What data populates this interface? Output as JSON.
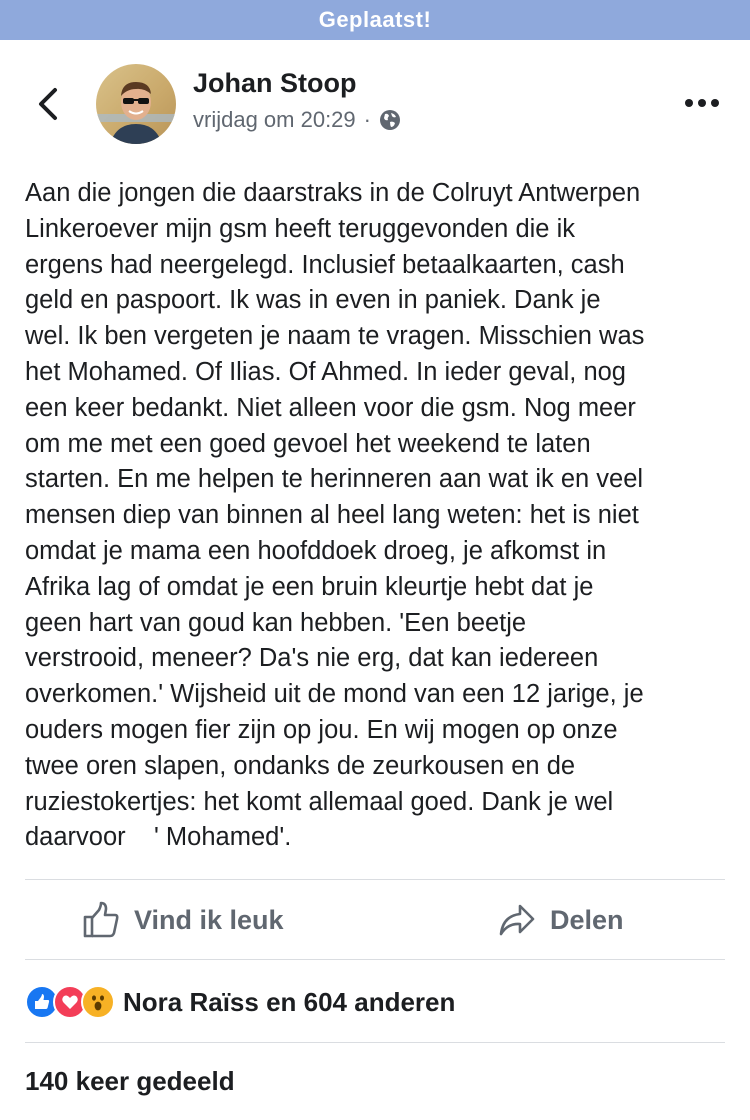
{
  "status_banner": {
    "text": "Geplaatst!",
    "color": "#8fa9dc"
  },
  "header": {
    "back_icon": "chevron-left-icon",
    "author_name": "Johan Stoop",
    "timestamp": "vrijdag om 20:29",
    "separator": "·",
    "privacy_icon": "globe-icon",
    "more_icon": "more-horizontal-icon"
  },
  "post": {
    "text": "Aan die jongen die daarstraks in de Colruyt Antwerpen\nLinkeroever mijn gsm heeft teruggevonden die ik\nergens had neergelegd. Inclusief betaalkaarten, cash\ngeld en paspoort. Ik was in even in paniek. Dank je\nwel. Ik ben vergeten je naam te vragen. Misschien was\nhet Mohamed. Of Ilias. Of Ahmed. In ieder geval, nog\neen keer bedankt. Niet alleen voor die gsm. Nog meer\nom me met een goed gevoel het weekend te laten\nstarten. En me helpen te herinneren aan wat ik en veel\nmensen diep van binnen al heel lang weten: het is niet\nomdat je mama een hoofddoek droeg, je afkomst in\nAfrika lag of omdat je een bruin kleurtje hebt dat je\ngeen hart van goud kan hebben. 'Een beetje\nverstrooid, meneer? Da's nie erg, dat kan iedereen\noverkomen.' Wijsheid uit de mond van een 12 jarige, je\nouders mogen fier zijn op jou. En wij mogen op onze\ntwee oren slapen, ondanks de zeurkousen en de\nruziestokertjes: het komt allemaal goed. Dank je wel\ndaarvoor    ' Mohamed'."
  },
  "actions": {
    "like": {
      "label": "Vind ik leuk",
      "icon": "thumbs-up-icon"
    },
    "share": {
      "label": "Delen",
      "icon": "share-arrow-icon"
    }
  },
  "reactions": {
    "icons": [
      "like-reaction-icon",
      "love-reaction-icon",
      "wow-reaction-icon"
    ],
    "label": "Nora Raïss en 604 anderen",
    "colors": {
      "like": "#1877f2",
      "love": "#f33e58",
      "wow": "#f7b125"
    }
  },
  "shares": {
    "label": "140 keer gedeeld"
  }
}
